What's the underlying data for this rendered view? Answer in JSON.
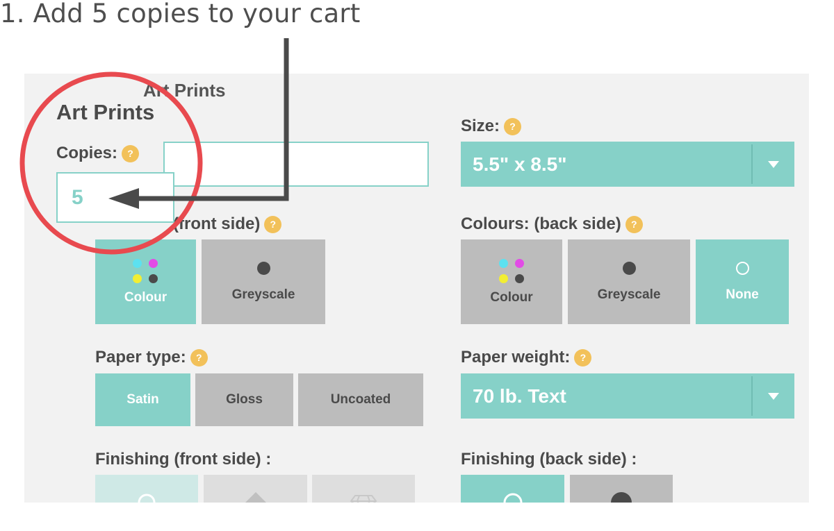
{
  "caption": "1. Add 5 copies to your cart",
  "product": {
    "title_behind": "Art Prints",
    "title": "Art Prints"
  },
  "help_glyph": "?",
  "copies": {
    "label": "Copies:",
    "value": "5"
  },
  "size": {
    "label": "Size:",
    "selected": "5.5\" x 8.5\""
  },
  "colours_front": {
    "label": "(front side)",
    "options": [
      {
        "label": "Colour",
        "selected": true
      },
      {
        "label": "Greyscale",
        "selected": false
      }
    ]
  },
  "colours_back": {
    "label": "Colours: (back side)",
    "options": [
      {
        "label": "Colour",
        "selected": false
      },
      {
        "label": "Greyscale",
        "selected": false
      },
      {
        "label": "None",
        "selected": true
      }
    ]
  },
  "paper_type": {
    "label": "Paper type:",
    "options": [
      {
        "label": "Satin",
        "selected": true
      },
      {
        "label": "Gloss",
        "selected": false
      },
      {
        "label": "Uncoated",
        "selected": false
      }
    ]
  },
  "paper_weight": {
    "label": "Paper weight:",
    "selected": "70 lb. Text"
  },
  "finishing_front": {
    "label": "Finishing (front side) :"
  },
  "finishing_back": {
    "label": "Finishing (back side) :"
  },
  "colors": {
    "accent": "#86d1c8",
    "unselected": "#bcbcbc",
    "help_badge": "#f2c15a",
    "highlight_circle": "#e84a4f",
    "arrow": "#4a4a4a",
    "cmyk": [
      "#5ce1f0",
      "#e24ce6",
      "#f2ee33",
      "#4a4a4a"
    ]
  },
  "icons": [
    "help-icon",
    "dropdown-caret-icon",
    "cmyk-dots-icon",
    "filled-circle-icon",
    "empty-circle-icon",
    "diamond-icon",
    "gem-icon",
    "arrow-icon"
  ]
}
